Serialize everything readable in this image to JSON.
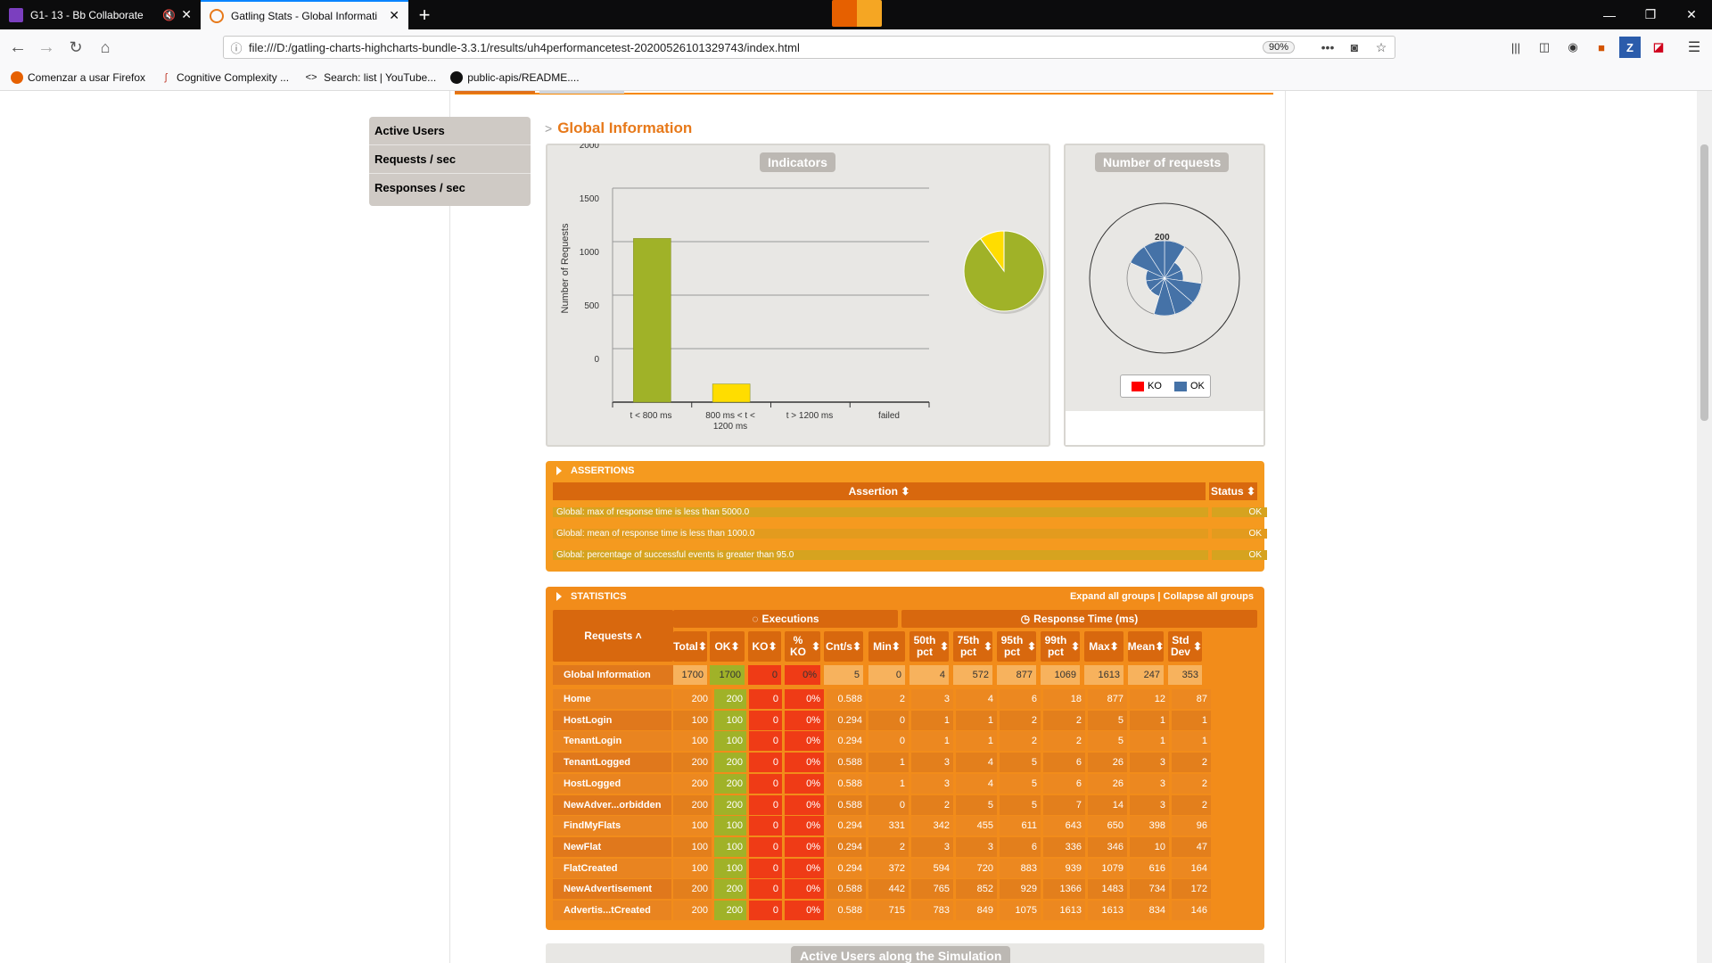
{
  "browser": {
    "tabs": [
      {
        "title": "G1- 13 - Bb Collaborate",
        "active": false
      },
      {
        "title": "Gatling Stats - Global Informati",
        "active": true
      }
    ],
    "new_tab": "+",
    "url": "file:///D:/gatling-charts-highcharts-bundle-3.3.1/results/uh4performancetest-20200526101329743/index.html",
    "zoom": "90%",
    "bookmarks": [
      "Comenzar a usar Firefox",
      "Cognitive Complexity ...",
      "Search: list | YouTube...",
      "public-apis/README...."
    ]
  },
  "menu": {
    "items": [
      "Active Users",
      "Requests / sec",
      "Responses / sec"
    ]
  },
  "page": {
    "section_title": "Global Information"
  },
  "indicators": {
    "title": "Indicators",
    "ylabel": "Number of Requests",
    "yticks": [
      "0",
      "500",
      "1000",
      "1500",
      "2000"
    ],
    "xticks": [
      "t < 800 ms",
      "800 ms < t <",
      "1200 ms",
      "t > 1200 ms",
      "failed"
    ]
  },
  "requests_panel": {
    "title": "Number of requests",
    "scale_label": "200",
    "legend": [
      "KO",
      "OK"
    ]
  },
  "chart_data": [
    {
      "type": "bar",
      "title": "Indicators",
      "ylabel": "Number of Requests",
      "categories": [
        "t < 800 ms",
        "800 ms < t < 1200 ms",
        "t > 1200 ms",
        "failed"
      ],
      "values": [
        1530,
        170,
        0,
        0
      ],
      "ylim": [
        0,
        2000
      ],
      "colors": [
        "#a0b228",
        "#ffdd00",
        "#f15b4f",
        "#f15b4f"
      ],
      "grid": true
    },
    {
      "type": "pie",
      "categories": [
        "t < 800 ms",
        "800 ms < t < 1200 ms"
      ],
      "values": [
        1530,
        170
      ],
      "colors": [
        "#a0b228",
        "#ffdd00"
      ]
    },
    {
      "type": "pie",
      "title": "Number of requests",
      "polar": true,
      "scale_max": 200,
      "categories": [
        "Home",
        "HostLogin",
        "TenantLogin",
        "TenantLogged",
        "HostLogged",
        "NewAdver...orbidden",
        "FindMyFlats",
        "NewFlat",
        "FlatCreated",
        "NewAdvertisement",
        "Advertis...tCreated"
      ],
      "series": [
        {
          "name": "OK",
          "color": "#4572a7",
          "values": [
            200,
            100,
            100,
            200,
            200,
            200,
            100,
            100,
            100,
            200,
            200
          ]
        },
        {
          "name": "KO",
          "color": "#ff0000",
          "values": [
            0,
            0,
            0,
            0,
            0,
            0,
            0,
            0,
            0,
            0,
            0
          ]
        }
      ]
    }
  ],
  "assertions": {
    "header": "ASSERTIONS",
    "col_assertion": "Assertion",
    "col_status": "Status",
    "rows": [
      {
        "text": "Global: max of response time is less than 5000.0",
        "status": "OK"
      },
      {
        "text": "Global: mean of response time is less than 1000.0",
        "status": "OK"
      },
      {
        "text": "Global: percentage of successful events is greater than 95.0",
        "status": "OK"
      }
    ]
  },
  "statistics": {
    "header": "STATISTICS",
    "expand_all": "Expand all groups",
    "separator": "|",
    "collapse_all": "Collapse all groups",
    "requests_header": "Requests",
    "executions_header": "Executions",
    "response_header": "Response Time (ms)",
    "columns": [
      "Total",
      "OK",
      "KO",
      "% KO",
      "Cnt/s",
      "Min",
      "50th pct",
      "75th pct",
      "95th pct",
      "99th pct",
      "Max",
      "Mean",
      "Std Dev"
    ],
    "global": {
      "name": "Global Information",
      "values": [
        "1700",
        "1700",
        "0",
        "0%",
        "5",
        "0",
        "4",
        "572",
        "877",
        "1069",
        "1613",
        "247",
        "353"
      ]
    },
    "rows": [
      {
        "name": "Home",
        "values": [
          "200",
          "200",
          "0",
          "0%",
          "0.588",
          "2",
          "3",
          "4",
          "6",
          "18",
          "877",
          "12",
          "87"
        ]
      },
      {
        "name": "HostLogin",
        "values": [
          "100",
          "100",
          "0",
          "0%",
          "0.294",
          "0",
          "1",
          "1",
          "2",
          "2",
          "5",
          "1",
          "1"
        ]
      },
      {
        "name": "TenantLogin",
        "values": [
          "100",
          "100",
          "0",
          "0%",
          "0.294",
          "0",
          "1",
          "1",
          "2",
          "2",
          "5",
          "1",
          "1"
        ]
      },
      {
        "name": "TenantLogged",
        "values": [
          "200",
          "200",
          "0",
          "0%",
          "0.588",
          "1",
          "3",
          "4",
          "5",
          "6",
          "26",
          "3",
          "2"
        ]
      },
      {
        "name": "HostLogged",
        "values": [
          "200",
          "200",
          "0",
          "0%",
          "0.588",
          "1",
          "3",
          "4",
          "5",
          "6",
          "26",
          "3",
          "2"
        ]
      },
      {
        "name": "NewAdver...orbidden",
        "values": [
          "200",
          "200",
          "0",
          "0%",
          "0.588",
          "0",
          "2",
          "5",
          "5",
          "7",
          "14",
          "3",
          "2"
        ]
      },
      {
        "name": "FindMyFlats",
        "values": [
          "100",
          "100",
          "0",
          "0%",
          "0.294",
          "331",
          "342",
          "455",
          "611",
          "643",
          "650",
          "398",
          "96"
        ]
      },
      {
        "name": "NewFlat",
        "values": [
          "100",
          "100",
          "0",
          "0%",
          "0.294",
          "2",
          "3",
          "3",
          "6",
          "336",
          "346",
          "10",
          "47"
        ]
      },
      {
        "name": "FlatCreated",
        "values": [
          "100",
          "100",
          "0",
          "0%",
          "0.294",
          "372",
          "594",
          "720",
          "883",
          "939",
          "1079",
          "616",
          "164"
        ]
      },
      {
        "name": "NewAdvertisement",
        "values": [
          "200",
          "200",
          "0",
          "0%",
          "0.588",
          "442",
          "765",
          "852",
          "929",
          "1366",
          "1483",
          "734",
          "172"
        ]
      },
      {
        "name": "Advertis...tCreated",
        "values": [
          "200",
          "200",
          "0",
          "0%",
          "0.588",
          "715",
          "783",
          "849",
          "1075",
          "1613",
          "1613",
          "834",
          "146"
        ]
      }
    ]
  },
  "bottom_panel": {
    "title": "Active Users along the Simulation"
  }
}
